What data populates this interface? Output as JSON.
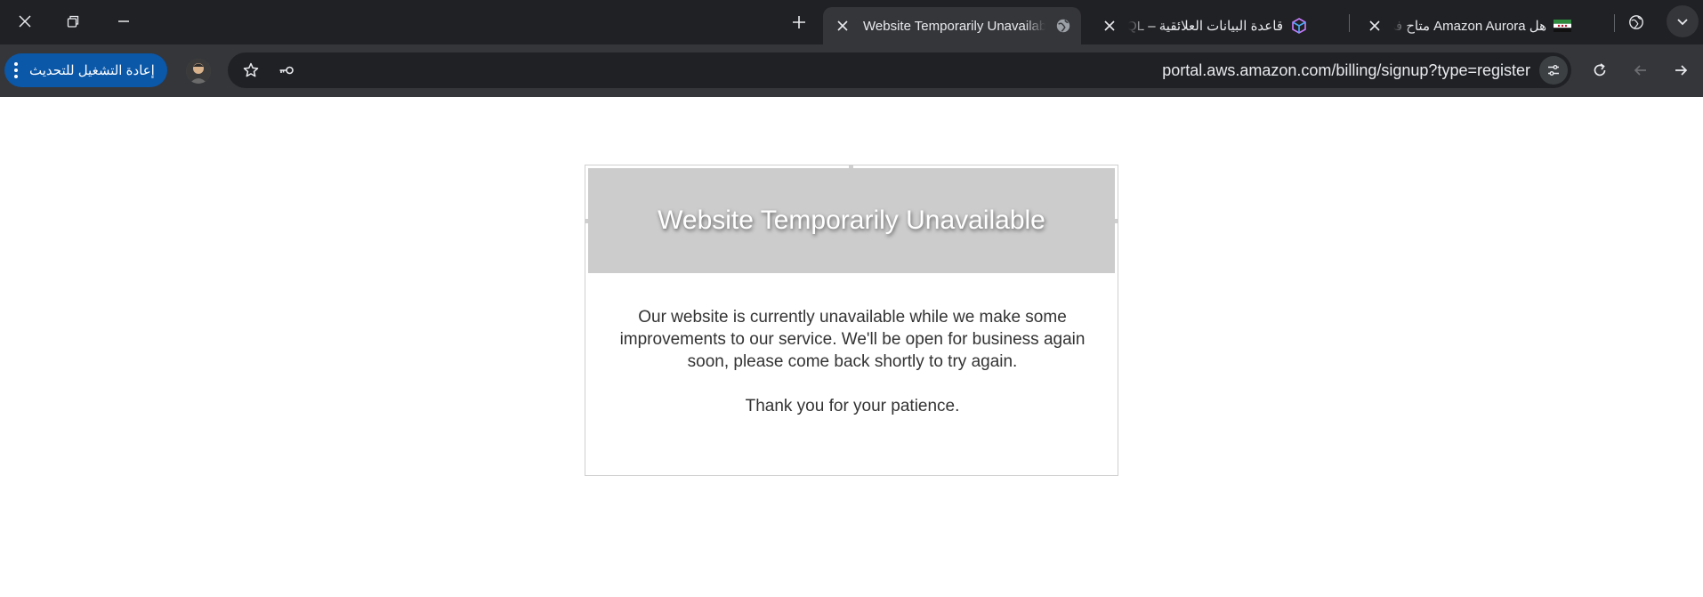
{
  "browser": {
    "tabs": [
      {
        "title": "Website Temporarily Unavailable",
        "active": true,
        "favicon": "globe-icon"
      },
      {
        "title": "قاعدة البيانات العلائقية – PostgreSQL",
        "active": false,
        "favicon": "aws-cube-icon"
      },
      {
        "title": "هل Amazon Aurora متاح في سوريا",
        "active": false,
        "favicon": "syria-flag-icon"
      }
    ],
    "update_button_label": "إعادة التشغيل للتحديث",
    "url": "portal.aws.amazon.com/billing/signup?type=register"
  },
  "page": {
    "title": "Website Temporarily Unavailable",
    "message": "Our website is currently unavailable while we make some improvements to our service. We'll be open for business again soon, please come back shortly to try again.",
    "thanks": "Thank you for your patience."
  },
  "colors": {
    "tab_strip": "#202124",
    "toolbar": "#35363a",
    "update_button": "#0b57a8",
    "card_header": "#cccccc"
  }
}
